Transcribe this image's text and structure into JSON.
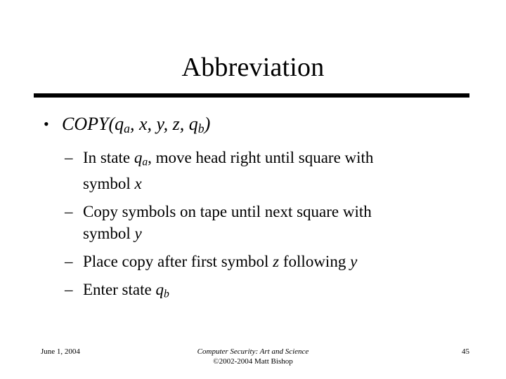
{
  "slide": {
    "title": "Abbreviation",
    "page_number": "45",
    "background_color": "#ffffff",
    "text_color": "#000000",
    "rule_color": "#000000"
  },
  "content": {
    "bullet_marker": "•",
    "sub_bullet_marker": "–",
    "level1": {
      "name": "COPY",
      "open_paren": "(",
      "arg1_base": "q",
      "arg1_sub": "a",
      "sep1": ", ",
      "arg2": "x",
      "sep2": ", ",
      "arg3": "y",
      "sep3": ", ",
      "arg4": "z",
      "sep4": ", ",
      "arg5_base": "q",
      "arg5_sub": "b",
      "close_paren": ")"
    },
    "sub_bullets": [
      {
        "pre": "In state ",
        "var_base": "q",
        "var_sub": "a",
        "post": ", move head right until square with",
        "line2_pre": "symbol ",
        "line2_var": "x",
        "line2_post": ""
      },
      {
        "pre": "Copy symbols on tape until next square with",
        "var_base": "",
        "var_sub": "",
        "post": "",
        "line2_pre": "symbol ",
        "line2_var": "y",
        "line2_post": ""
      },
      {
        "pre": "Place copy after first symbol ",
        "var_base": "z",
        "var_sub": "",
        "post": " following ",
        "line2_pre": "",
        "line2_var": "y",
        "line2_post": ""
      },
      {
        "pre": "Enter state ",
        "var_base": "q",
        "var_sub": "b",
        "post": "",
        "line2_pre": "",
        "line2_var": "",
        "line2_post": ""
      }
    ]
  },
  "footer": {
    "date": "June 1, 2004",
    "book_title": "Computer Security: Art and Science",
    "copyright": "©2002-2004 Matt Bishop",
    "page": "45"
  }
}
